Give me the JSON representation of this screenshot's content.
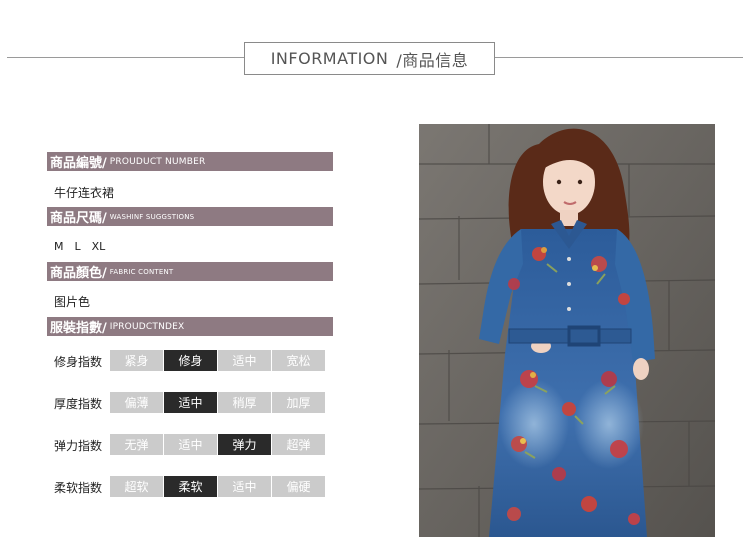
{
  "header": {
    "title_en": "INFORMATION",
    "title_zh": "/商品信息"
  },
  "sections": [
    {
      "zh": "商品編號/",
      "en": "PROUDUCT NUMBER",
      "value": "牛仔连衣裙"
    },
    {
      "zh": "商品尺碼/",
      "en": "WASHINF SUGGSTIONS",
      "value": "M　L　XL"
    },
    {
      "zh": "商品顏色/",
      "en": "FABRIC CONTENT",
      "value": "图片色"
    },
    {
      "zh": "服裝指數/",
      "en": "IPROUDCTNDEX"
    }
  ],
  "ratings": [
    {
      "label": "修身指数",
      "options": [
        "紧身",
        "修身",
        "适中",
        "宽松"
      ],
      "selected": "修身"
    },
    {
      "label": "厚度指数",
      "options": [
        "偏薄",
        "适中",
        "稍厚",
        "加厚"
      ],
      "selected": "适中"
    },
    {
      "label": "弹力指数",
      "options": [
        "无弹",
        "适中",
        "弹力",
        "超弹"
      ],
      "selected": "弹力"
    },
    {
      "label": "柔软指数",
      "options": [
        "超软",
        "柔软",
        "适中",
        "偏硬"
      ],
      "selected": "柔软"
    }
  ],
  "colors": {
    "bar": "#8e7a82",
    "option": "#cbcbcb",
    "option_selected": "#2a2a2a"
  }
}
